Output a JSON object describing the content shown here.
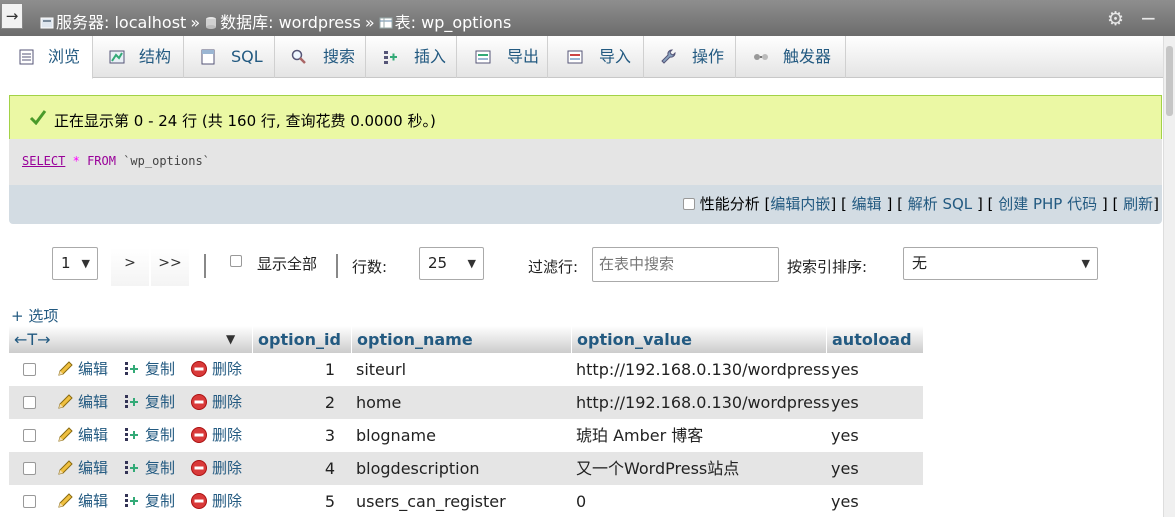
{
  "breadcrumb": {
    "collapse": "→",
    "server": "服务器: localhost",
    "database": "数据库: wordpress",
    "table": "表: wp_options",
    "sep": "»"
  },
  "tabs": [
    {
      "label": "浏览",
      "icon": "browse-icon"
    },
    {
      "label": "结构",
      "icon": "structure-icon"
    },
    {
      "label": "SQL",
      "icon": "sql-icon"
    },
    {
      "label": "搜索",
      "icon": "search-icon"
    },
    {
      "label": "插入",
      "icon": "insert-icon"
    },
    {
      "label": "导出",
      "icon": "export-icon"
    },
    {
      "label": "导入",
      "icon": "import-icon"
    },
    {
      "label": "操作",
      "icon": "wrench-icon"
    },
    {
      "label": "触发器",
      "icon": "trigger-icon"
    }
  ],
  "message": {
    "text": "正在显示第 0 - 24 行 (共 160 行, 查询花费 0.0000 秒。)"
  },
  "sql": {
    "select": "SELECT",
    "star": "*",
    "from": "FROM",
    "table": "`wp_options`"
  },
  "actions": {
    "profiling": "性能分析",
    "edit_inline": "编辑内嵌",
    "edit": "编辑",
    "explain": "解析 SQL",
    "create_php": "创建 PHP 代码",
    "refresh": "刷新"
  },
  "nav": {
    "page": "1",
    "next": ">",
    "last": ">>",
    "show_all": "显示全部",
    "rows_label": "行数:",
    "rows_value": "25",
    "filter_label": "过滤行:",
    "filter_placeholder": "在表中搜索",
    "sort_label": "按索引排序:",
    "sort_value": "无"
  },
  "options_link": "+ 选项",
  "table": {
    "arrows": "←T→",
    "columns": [
      "option_id",
      "option_name",
      "option_value",
      "autoload"
    ],
    "row_actions": {
      "edit": "编辑",
      "copy": "复制",
      "delete": "删除"
    },
    "rows": [
      {
        "id": "1",
        "name": "siteurl",
        "value": "http://192.168.0.130/wordpress",
        "autoload": "yes"
      },
      {
        "id": "2",
        "name": "home",
        "value": "http://192.168.0.130/wordpress",
        "autoload": "yes"
      },
      {
        "id": "3",
        "name": "blogname",
        "value": "琥珀 Amber 博客",
        "autoload": "yes"
      },
      {
        "id": "4",
        "name": "blogdescription",
        "value": "又一个WordPress站点",
        "autoload": "yes"
      },
      {
        "id": "5",
        "name": "users_can_register",
        "value": "0",
        "autoload": "yes"
      }
    ]
  },
  "colors": {
    "link": "#235a81",
    "success_bg": "#ebf8a4",
    "row_even": "#e5e5e5"
  }
}
